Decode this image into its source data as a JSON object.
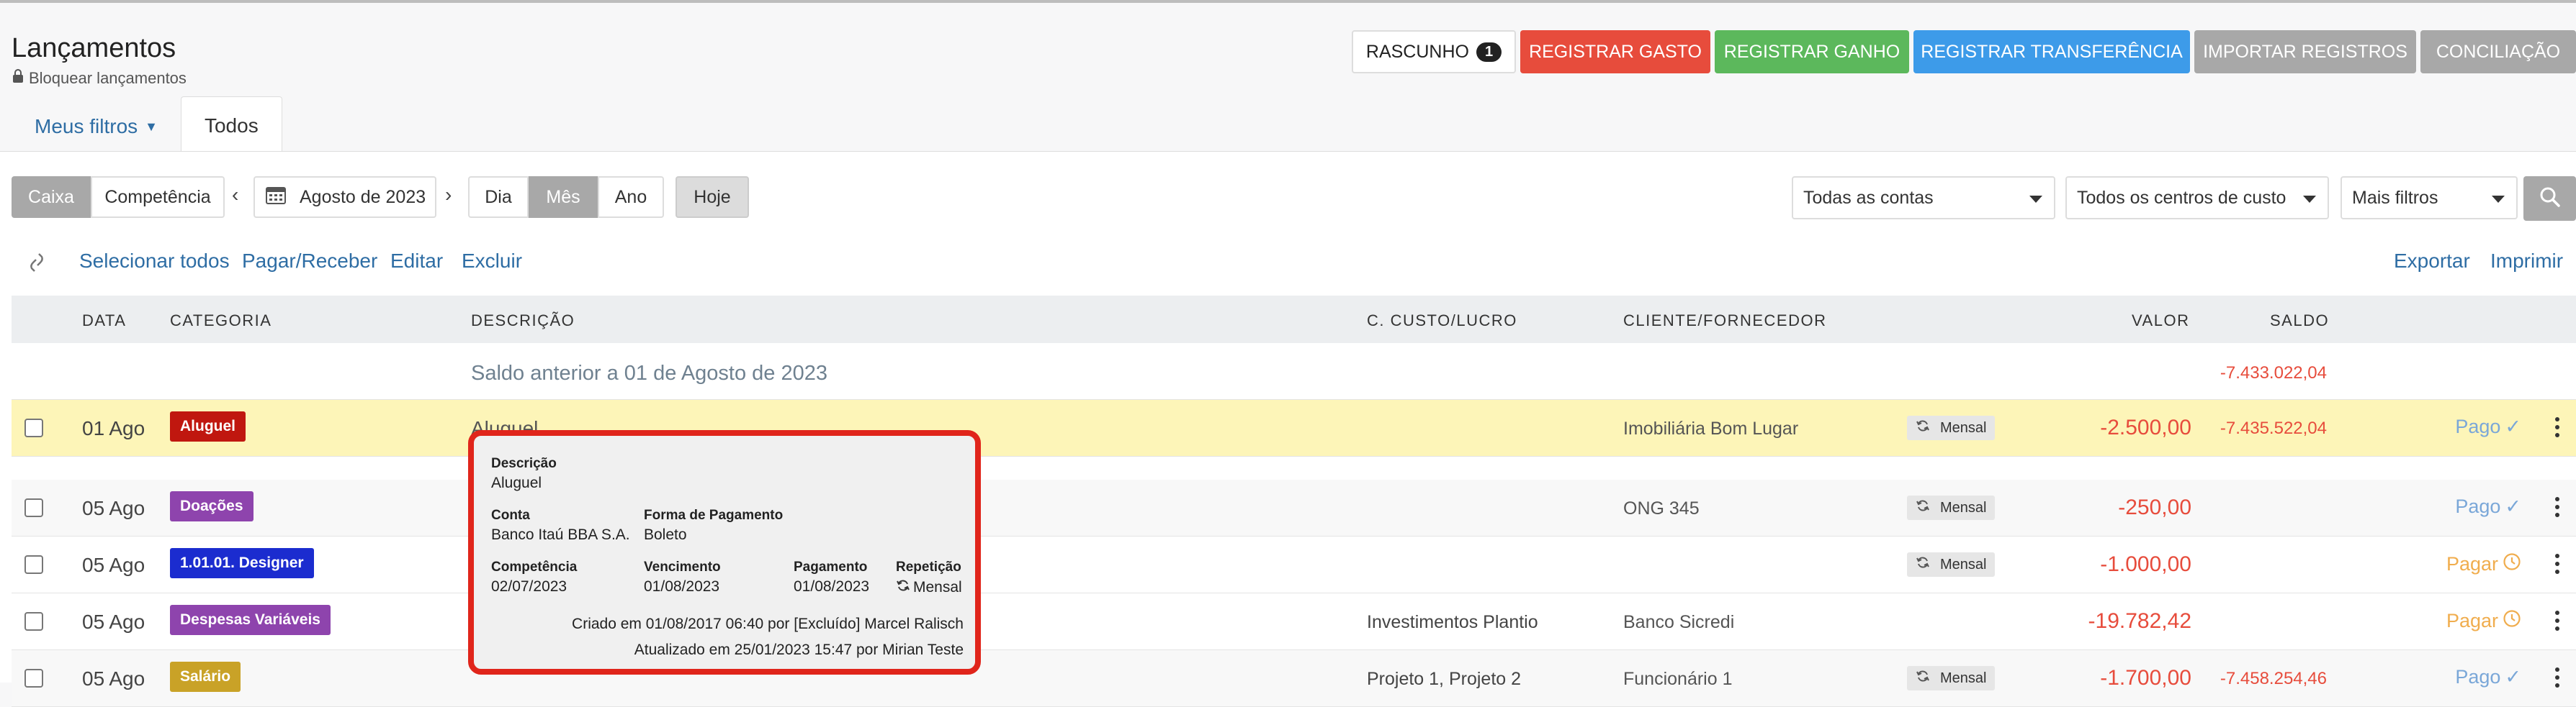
{
  "header": {
    "title": "Lançamentos",
    "lock_label": "Bloquear lançamentos",
    "actions": {
      "rascunho": "RASCUNHO",
      "rascunho_count": "1",
      "registrar_gasto": "REGISTRAR GASTO",
      "registrar_ganho": "REGISTRAR GANHO",
      "registrar_transferencia": "REGISTRAR TRANSFERÊNCIA",
      "importar_registros": "IMPORTAR REGISTROS",
      "conciliacao": "CONCILIAÇÃO"
    },
    "tabs": {
      "filters": "Meus filtros",
      "all": "Todos"
    }
  },
  "toolbar": {
    "regime": {
      "caixa": "Caixa",
      "competencia": "Competência",
      "selected": "Caixa"
    },
    "prev": "‹",
    "next": "›",
    "period": "Agosto de 2023",
    "granularity": {
      "dia": "Dia",
      "mes": "Mês",
      "ano": "Ano",
      "selected": "Mês"
    },
    "hoje": "Hoje",
    "contas": "Todas as contas",
    "centros": "Todos os centros de custo",
    "mais_filtros": "Mais filtros"
  },
  "links": {
    "selecionar_todos": "Selecionar todos",
    "pagar_receber": "Pagar/Receber",
    "editar": "Editar",
    "excluir": "Excluir",
    "exportar": "Exportar",
    "imprimir": "Imprimir"
  },
  "table": {
    "headers": {
      "data": "DATA",
      "categoria": "CATEGORIA",
      "descricao": "DESCRIÇÃO",
      "ccusto": "C. CUSTO/LUCRO",
      "cliente": "CLIENTE/FORNECEDOR",
      "valor": "VALOR",
      "saldo": "SALDO"
    },
    "saldo_anterior": {
      "label": "Saldo anterior a 01 de Agosto de 2023",
      "value": "-7.433.022,04"
    },
    "rows": [
      {
        "date": "01 Ago",
        "category": "Aluguel",
        "category_color": "#c0170f",
        "description": "Aluguel",
        "ccusto": "",
        "cliente": "Imobiliária Bom Lugar",
        "recurrence": "Mensal",
        "valor": "-2.500,00",
        "saldo": "-7.435.522,04",
        "status": "Pago"
      },
      {
        "date": "05 Ago",
        "category": "Doações",
        "category_color": "#8e44ad",
        "description": "",
        "ccusto": "",
        "cliente": "ONG 345",
        "recurrence": "Mensal",
        "valor": "-250,00",
        "saldo": "",
        "status": "Pago"
      },
      {
        "date": "05 Ago",
        "category": "1.01.01. Designer",
        "category_color": "#1b2ccf",
        "description": "",
        "ccusto": "",
        "cliente": "",
        "recurrence": "Mensal",
        "valor": "-1.000,00",
        "saldo": "",
        "status": "Pagar"
      },
      {
        "date": "05 Ago",
        "category": "Despesas Variáveis",
        "category_color": "#8e44ad",
        "description": "",
        "ccusto": "Investimentos Plantio",
        "cliente": "Banco Sicredi",
        "recurrence": "",
        "valor": "-19.782,42",
        "saldo": "",
        "status": "Pagar"
      },
      {
        "date": "05 Ago",
        "category": "Salário",
        "category_color": "#c9a227",
        "description": "",
        "ccusto": "Projeto 1, Projeto 2",
        "cliente": "Funcionário 1",
        "recurrence": "Mensal",
        "valor": "-1.700,00",
        "saldo": "-7.458.254,46",
        "status": "Pago"
      }
    ]
  },
  "popover": {
    "descricao_label": "Descrição",
    "descricao": "Aluguel",
    "conta_label": "Conta",
    "conta": "Banco Itaú BBA S.A.",
    "forma_label": "Forma de Pagamento",
    "forma": "Boleto",
    "competencia_label": "Competência",
    "competencia": "02/07/2023",
    "vencimento_label": "Vencimento",
    "vencimento": "01/08/2023",
    "pagamento_label": "Pagamento",
    "pagamento": "01/08/2023",
    "repeticao_label": "Repetição",
    "repeticao": "Mensal",
    "criado": "Criado em 01/08/2017 06:40 por [Excluído] Marcel Ralisch",
    "atualizado": "Atualizado em 25/01/2023 15:47 por Mirian Teste"
  },
  "icons": {
    "lock": "lock-icon",
    "calendar": "calendar-icon",
    "search": "search-icon",
    "link": "link-icon",
    "recurrence": "refresh-icon",
    "check": "check-icon",
    "clock": "clock-icon",
    "kebab": "kebab-icon"
  },
  "colors": {
    "danger": "#e74c3c",
    "success": "#5cb85c",
    "primary": "#3d9be9",
    "neutral": "#a8a8a8",
    "highlight": "#fdf5b8",
    "pago": "#7aa7d8",
    "pagar": "#f0ad4e"
  }
}
